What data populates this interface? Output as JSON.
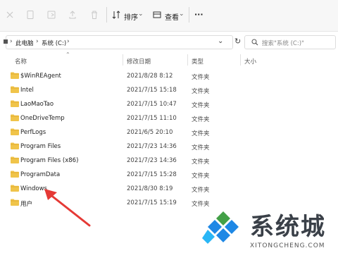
{
  "toolbar": {
    "sort_label": "排序",
    "view_label": "查看",
    "more_label": "···"
  },
  "address": {
    "crumbs": [
      "此电脑",
      "系统 (C:)"
    ],
    "search_placeholder": "搜索\"系统 (C:)\""
  },
  "columns": {
    "name": "名称",
    "modified": "修改日期",
    "type": "类型",
    "size": "大小"
  },
  "rows": [
    {
      "name": "$WinREAgent",
      "date": "2021/8/28 8:12",
      "type": "文件夹"
    },
    {
      "name": "Intel",
      "date": "2021/7/15 15:18",
      "type": "文件夹"
    },
    {
      "name": "LaoMaoTao",
      "date": "2021/7/15 10:47",
      "type": "文件夹"
    },
    {
      "name": "OneDriveTemp",
      "date": "2021/7/15 11:10",
      "type": "文件夹"
    },
    {
      "name": "PerfLogs",
      "date": "2021/6/5 20:10",
      "type": "文件夹"
    },
    {
      "name": "Program Files",
      "date": "2021/7/23 14:36",
      "type": "文件夹"
    },
    {
      "name": "Program Files (x86)",
      "date": "2021/7/23 14:36",
      "type": "文件夹"
    },
    {
      "name": "ProgramData",
      "date": "2021/7/15 15:28",
      "type": "文件夹"
    },
    {
      "name": "Windows",
      "date": "2021/8/30 8:19",
      "type": "文件夹"
    },
    {
      "name": "用户",
      "date": "2021/7/15 15:19",
      "type": "文件夹"
    }
  ],
  "watermark": {
    "text": "系统城",
    "url": "XITONGCHENG.COM"
  },
  "colors": {
    "folder": "#f0c44a",
    "folder_dark": "#dfa92a",
    "arrow": "#e53935",
    "logo_blue": "#1e88e5",
    "logo_green": "#43a047"
  }
}
